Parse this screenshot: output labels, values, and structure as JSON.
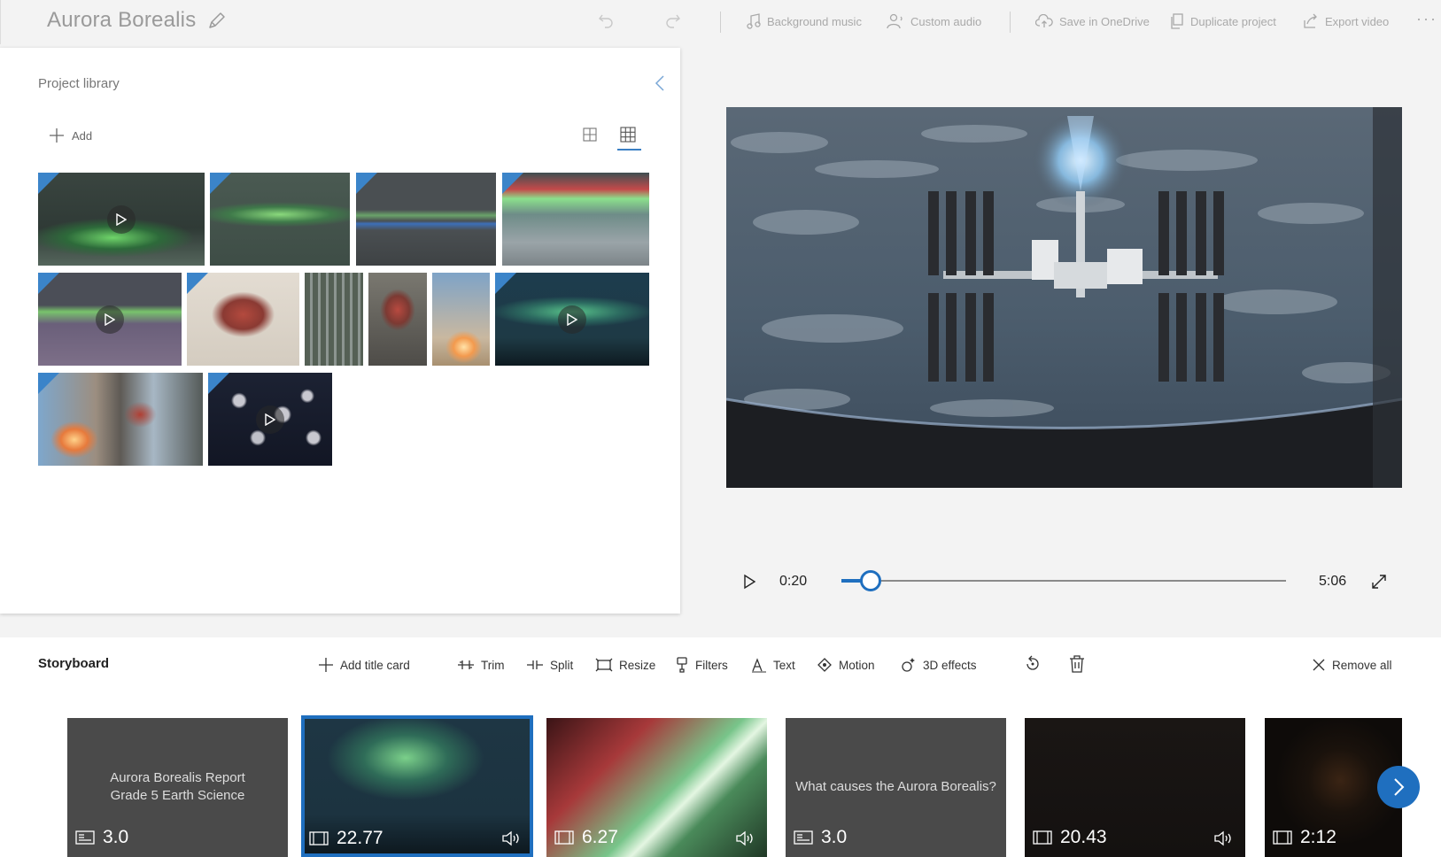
{
  "header": {
    "project_title": "Aurora Borealis",
    "actions": {
      "background_music": "Background music",
      "custom_audio": "Custom audio",
      "save_onedrive": "Save in OneDrive",
      "duplicate": "Duplicate project",
      "export": "Export video"
    },
    "more_label": "···"
  },
  "library": {
    "title": "Project library",
    "add_label": "Add"
  },
  "player": {
    "current_time": "0:20",
    "total_time": "5:06",
    "progress": 0.065
  },
  "storyboard": {
    "title": "Storyboard",
    "tools": {
      "add_title_card": "Add title card",
      "trim": "Trim",
      "split": "Split",
      "resize": "Resize",
      "filters": "Filters",
      "text": "Text",
      "motion": "Motion",
      "effects_3d": "3D effects",
      "remove_all": "Remove all"
    },
    "cards": [
      {
        "kind": "title",
        "line1": "Aurora Borealis Report",
        "line2": "Grade 5 Earth Science",
        "duration": "3.0"
      },
      {
        "kind": "video",
        "duration": "22.77",
        "audio": true
      },
      {
        "kind": "video",
        "duration": "6.27",
        "audio": true
      },
      {
        "kind": "title",
        "line1": "What causes the Aurora Borealis?",
        "line2": "",
        "duration": "3.0"
      },
      {
        "kind": "video",
        "duration": "20.43",
        "audio": true
      },
      {
        "kind": "video",
        "duration": "2:12",
        "audio": false
      }
    ]
  },
  "colors": {
    "accent": "#1f6fbf",
    "thumb_corner": "#3b84c9"
  }
}
